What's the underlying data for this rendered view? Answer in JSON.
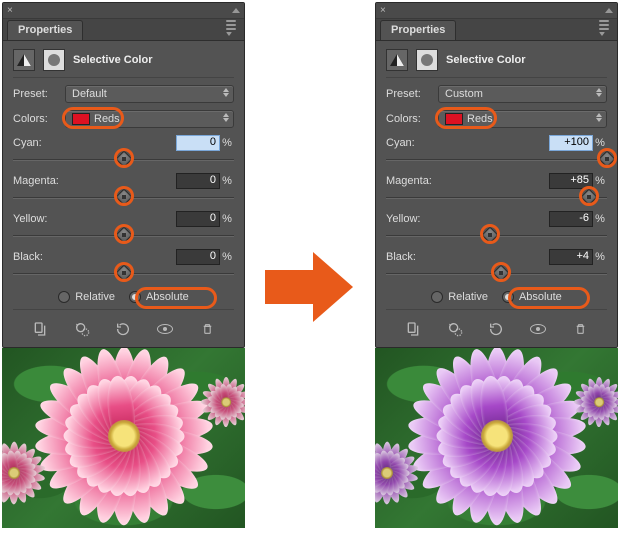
{
  "annotation_color": "#e85a1a",
  "panels": [
    {
      "id": "left",
      "titlebar": {
        "close": "×"
      },
      "tab": "Properties",
      "adjustment_title": "Selective Color",
      "preset": {
        "label": "Preset:",
        "value": "Default"
      },
      "colors": {
        "label": "Colors:",
        "value": "Reds",
        "swatch": "#d12"
      },
      "sliders": [
        {
          "label": "Cyan:",
          "value": "0",
          "percent": 50,
          "pct_label": "%",
          "focused": true
        },
        {
          "label": "Magenta:",
          "value": "0",
          "percent": 50,
          "pct_label": "%",
          "focused": false
        },
        {
          "label": "Yellow:",
          "value": "0",
          "percent": 50,
          "pct_label": "%",
          "focused": false
        },
        {
          "label": "Black:",
          "value": "0",
          "percent": 50,
          "pct_label": "%",
          "focused": false
        }
      ],
      "method": {
        "relative": "Relative",
        "absolute": "Absolute",
        "selected": "absolute"
      },
      "flower_color": "pink"
    },
    {
      "id": "right",
      "titlebar": {
        "close": "×"
      },
      "tab": "Properties",
      "adjustment_title": "Selective Color",
      "preset": {
        "label": "Preset:",
        "value": "Custom"
      },
      "colors": {
        "label": "Colors:",
        "value": "Reds",
        "swatch": "#d12"
      },
      "sliders": [
        {
          "label": "Cyan:",
          "value": "+100",
          "percent": 100,
          "pct_label": "%",
          "focused": true
        },
        {
          "label": "Magenta:",
          "value": "+85",
          "percent": 92,
          "pct_label": "%",
          "focused": false
        },
        {
          "label": "Yellow:",
          "value": "-6",
          "percent": 47,
          "pct_label": "%",
          "focused": false
        },
        {
          "label": "Black:",
          "value": "+4",
          "percent": 52,
          "pct_label": "%",
          "focused": false
        }
      ],
      "method": {
        "relative": "Relative",
        "absolute": "Absolute",
        "selected": "absolute"
      },
      "flower_color": "purple"
    }
  ]
}
